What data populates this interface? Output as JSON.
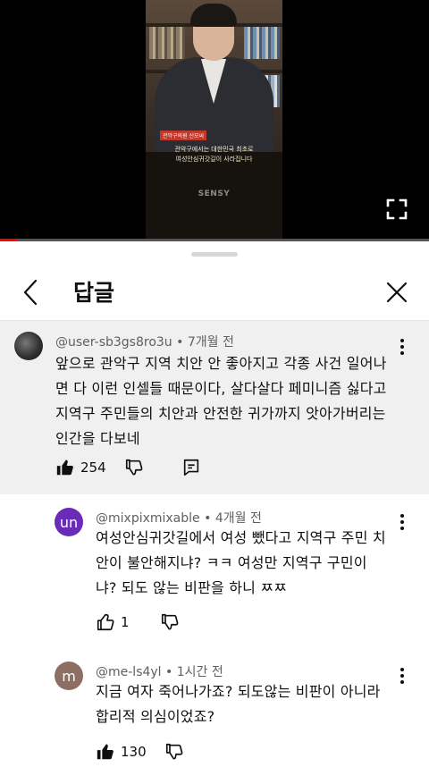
{
  "video": {
    "caption_tag": "관악구의원 신모씨",
    "caption_line1": "관악구에서는 대한민국 최초로",
    "caption_line2": "여성안심귀갓길이 사라집니다",
    "brand": "SENSY",
    "progress": 0.04
  },
  "header": {
    "title": "답글"
  },
  "comments": [
    {
      "author": "@user-sb3gs8ro3u",
      "time": "7개월 전",
      "text": "앞으로 관악구 지역 치안 안 좋아지고 각종 사건 일어나\n면 다 이런 인셀들 때문이다, 살다살다 페미니즘 싫다고\n지역구 주민들의 치안과 안전한 귀가까지 앗아가버리는\n인간을 다보네",
      "likes": "254"
    },
    {
      "author": "@mixpixmixable",
      "time": "4개월 전",
      "avatar_letter": "un",
      "avatar_color": "#6a2bb8",
      "text": "여성안심귀갓길에서 여성 뺐다고 지역구 주민 치\n안이 불안해지냐? ㅋㅋ 여성만 지역구 구민이\n냐? 되도 않는 비판을 하니 ㅉㅉ",
      "likes": "1"
    },
    {
      "author": "@me-ls4yl",
      "time": "1시간 전",
      "avatar_letter": "m",
      "avatar_color": "#8d6e63",
      "text": "지금 여자 죽어나가죠? 되도않는 비판이 아니라\n합리적 의심이었죠?",
      "likes": "130"
    }
  ],
  "meta_separator": " • "
}
